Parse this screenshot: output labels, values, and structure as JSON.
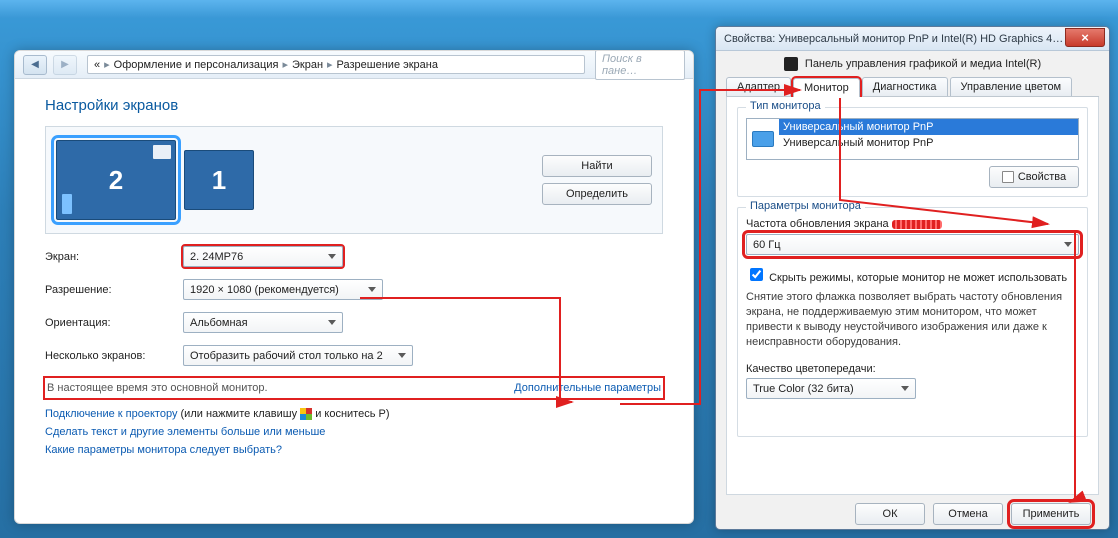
{
  "control_panel": {
    "breadcrumb": {
      "root_icon": "«",
      "item1": "Оформление и персонализация",
      "item2": "Экран",
      "item3": "Разрешение экрана"
    },
    "search_placeholder": "Поиск в пане…",
    "heading": "Настройки экранов",
    "monitors": {
      "label1": "1",
      "label2": "2"
    },
    "buttons": {
      "find": "Найти",
      "identify": "Определить"
    },
    "rows": {
      "screen_label": "Экран:",
      "screen_value": "2. 24MP76",
      "resolution_label": "Разрешение:",
      "resolution_value": "1920 × 1080 (рекомендуется)",
      "orientation_label": "Ориентация:",
      "orientation_value": "Альбомная",
      "multi_label": "Несколько экранов:",
      "multi_value": "Отобразить рабочий стол только на 2"
    },
    "note_primary": "В настоящее время это основной монитор.",
    "link_advanced": "Дополнительные параметры",
    "link_projector_a": "Подключение к проектору",
    "link_projector_b": "(или нажмите клавишу",
    "link_projector_c": "и коснитесь P)",
    "link_textsize": "Сделать текст и другие элементы больше или меньше",
    "link_which": "Какие параметры монитора следует выбрать?"
  },
  "dialog": {
    "title": "Свойства: Универсальный монитор PnP и Intel(R) HD Graphics 4…",
    "intel_bar": "Панель управления графикой и медиа Intel(R)",
    "tabs": {
      "adapter": "Адаптер",
      "monitor": "Монитор",
      "diag": "Диагностика",
      "color": "Управление цветом"
    },
    "grp_monitor_type": "Тип монитора",
    "monitor_items": {
      "sel": "Универсальный монитор PnP",
      "second": "Универсальный монитор PnP"
    },
    "btn_props": "Свойства",
    "grp_monitor_params": "Параметры монитора",
    "refresh_label": "Частота обновления экрана",
    "refresh_value": "60 Гц",
    "hide_modes": "Скрыть режимы, которые монитор не может использовать",
    "hide_help": "Снятие этого флажка позволяет выбрать частоту обновления экрана, не поддерживаемую этим монитором, что может привести к выводу неустойчивого изображения или даже к неисправности оборудования.",
    "color_quality_label": "Качество цветопередачи:",
    "color_quality_value": "True Color (32 бита)",
    "footer": {
      "ok": "ОК",
      "cancel": "Отмена",
      "apply": "Применить"
    }
  }
}
